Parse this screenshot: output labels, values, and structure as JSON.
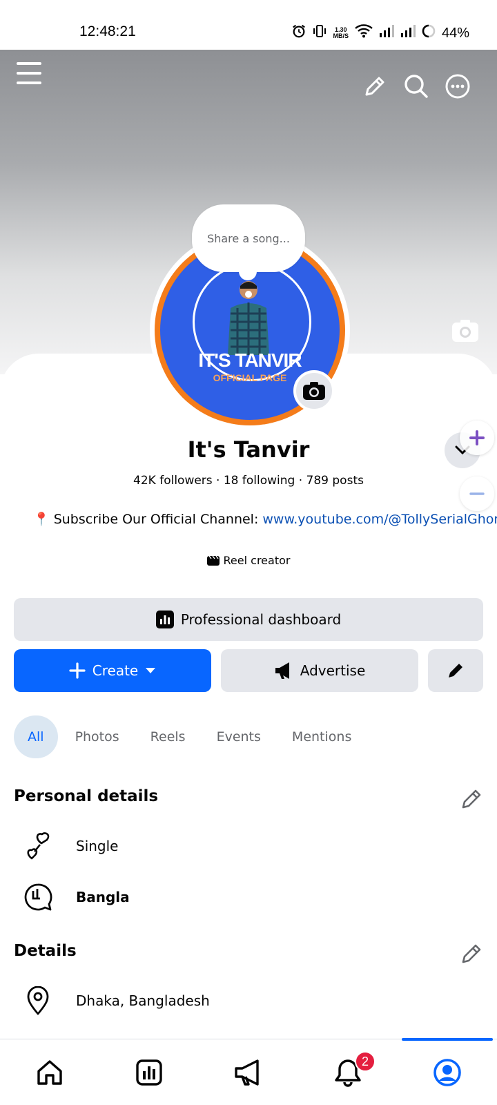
{
  "status_bar": {
    "time": "12:48:21",
    "net_speed_top": "1.30",
    "net_speed_unit": "MB/S",
    "battery": "44%"
  },
  "profile": {
    "name": "It's Tanvir",
    "stats": "42K followers · 18 following · 789 posts",
    "bio_prefix": "📍 Subscribe Our Official Channel: ",
    "bio_link": "www.youtube.com/@TollySerialGhor",
    "category": "Reel creator",
    "song_prompt": "Share a song...",
    "avatar_brand": "IT'S TANVIR",
    "avatar_sub": "OFFICIAL PAGE"
  },
  "buttons": {
    "professional_dashboard": "Professional dashboard",
    "create": "Create",
    "advertise": "Advertise"
  },
  "tabs": [
    {
      "label": "All",
      "active": true
    },
    {
      "label": "Photos",
      "active": false
    },
    {
      "label": "Reels",
      "active": false
    },
    {
      "label": "Events",
      "active": false
    },
    {
      "label": "Mentions",
      "active": false
    }
  ],
  "personal_details": {
    "title": "Personal details",
    "items": [
      {
        "icon": "relationship-icon",
        "text": "Single"
      },
      {
        "icon": "language-icon",
        "text": "Bangla"
      }
    ]
  },
  "details": {
    "title": "Details",
    "items": [
      {
        "icon": "location-icon",
        "text": "Dhaka, Bangladesh"
      }
    ]
  },
  "nav": {
    "notification_count": "2"
  },
  "colors": {
    "accent": "#0866ff",
    "link": "#0a4fb3",
    "badge": "#e41e3f",
    "button_grey": "#e4e6eb"
  }
}
